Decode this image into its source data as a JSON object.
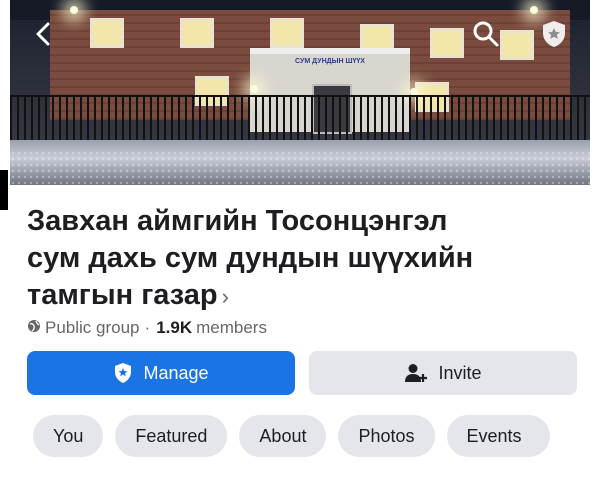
{
  "header": {
    "cover_sign": "СУМ ДУНДЫН ШҮҮХ",
    "icons": [
      "back-icon",
      "search-icon",
      "shield-star-icon"
    ]
  },
  "group": {
    "title_line1": "Завхан аймгийн Тосонцэнгэл",
    "title_line2": "сум дахь сум дундын шүүхийн",
    "title_line3": "тамгын газар",
    "privacy": "Public group",
    "separator": "·",
    "member_count": "1.9K",
    "members_label": "members"
  },
  "actions": {
    "manage_label": "Manage",
    "invite_label": "Invite"
  },
  "tabs": [
    {
      "label": "You"
    },
    {
      "label": "Featured"
    },
    {
      "label": "About"
    },
    {
      "label": "Photos"
    },
    {
      "label": "Events"
    }
  ],
  "colors": {
    "accent": "#1b74e4",
    "secondary_button": "#e4e6eb",
    "text": "#1c1e21",
    "muted": "#65676b"
  }
}
